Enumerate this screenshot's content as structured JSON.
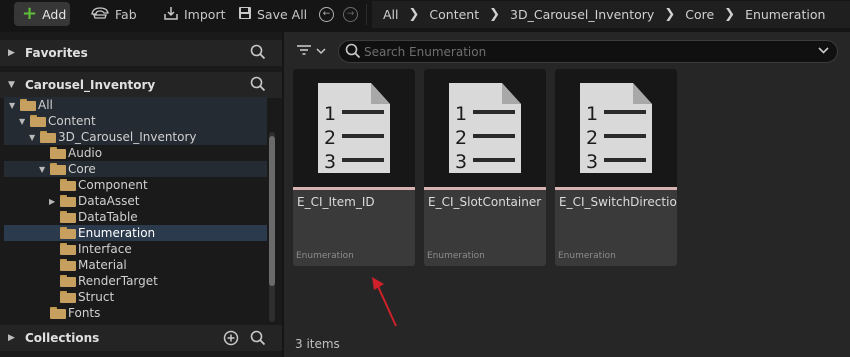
{
  "toolbar": {
    "add_label": "Add",
    "fab_label": "Fab",
    "import_label": "Import",
    "save_all_label": "Save All"
  },
  "breadcrumb": [
    "All",
    "Content",
    "3D_Carousel_Inventory",
    "Core",
    "Enumeration"
  ],
  "left_panel": {
    "favorites_label": "Favorites",
    "project_label": "Carousel_Inventory",
    "collections_label": "Collections",
    "tree": [
      {
        "label": "All"
      },
      {
        "label": "Content"
      },
      {
        "label": "3D_Carousel_Inventory"
      },
      {
        "label": "Audio"
      },
      {
        "label": "Core"
      },
      {
        "label": "Component"
      },
      {
        "label": "DataAsset"
      },
      {
        "label": "DataTable"
      },
      {
        "label": "Enumeration"
      },
      {
        "label": "Interface"
      },
      {
        "label": "Material"
      },
      {
        "label": "RenderTarget"
      },
      {
        "label": "Struct"
      },
      {
        "label": "Fonts"
      }
    ]
  },
  "content": {
    "search_placeholder": "Search Enumeration",
    "assets": [
      {
        "name": "E_CI_Item_ID",
        "type": "Enumeration"
      },
      {
        "name": "E_CI_SlotContainer",
        "type": "Enumeration"
      },
      {
        "name": "E_CI_SwitchDirection",
        "type": "Enumeration"
      }
    ],
    "item_count": "3 items",
    "doc_icon_numbers": [
      "1",
      "2",
      "3"
    ]
  },
  "colors": {
    "add_plus": "#5fbf3a",
    "folder": "#c7a060",
    "selection": "#2b3a4d",
    "asset_stripe": "#d7b2b2",
    "annotation_arrow": "#d0202a"
  },
  "icons": [
    "plus-icon",
    "fab-icon",
    "import-icon",
    "save-icon",
    "back-icon",
    "forward-icon",
    "search-icon",
    "filter-icon",
    "folder-icon",
    "enum-document-icon",
    "add-collection-icon"
  ]
}
